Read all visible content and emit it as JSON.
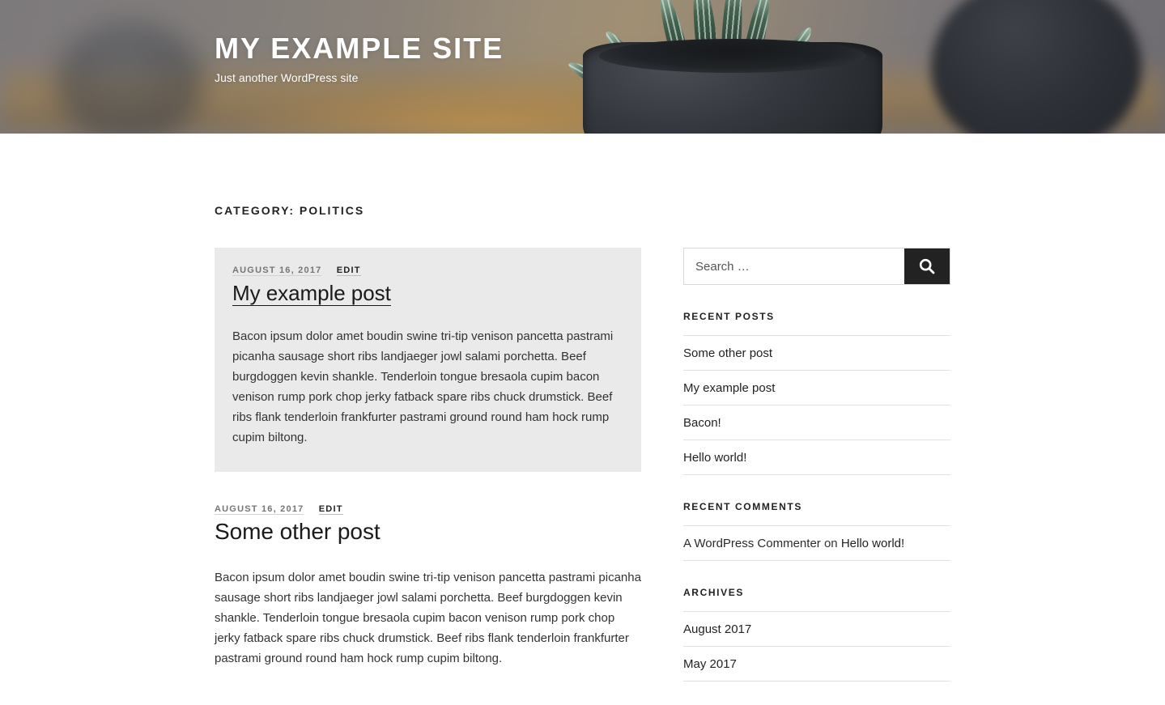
{
  "site": {
    "title": "MY EXAMPLE SITE",
    "description": "Just another WordPress site",
    "header_image": "potted-zebra-plant-photo"
  },
  "archive": {
    "page_title": "CATEGORY: POLITICS"
  },
  "posts": [
    {
      "sticky": true,
      "date": "AUGUST 16, 2017",
      "edit_label": "EDIT",
      "title": "My example post",
      "title_hovered": true,
      "excerpt": "Bacon ipsum dolor amet boudin swine tri-tip venison pancetta pastrami picanha sausage short ribs landjaeger jowl salami porchetta. Beef burgdoggen kevin shankle. Tenderloin tongue bresaola cupim bacon venison rump pork chop jerky fatback spare ribs chuck drumstick. Beef ribs flank tenderloin frankfurter pastrami ground round ham hock rump cupim biltong."
    },
    {
      "sticky": false,
      "date": "AUGUST 16, 2017",
      "edit_label": "EDIT",
      "title": "Some other post",
      "title_hovered": false,
      "excerpt": "Bacon ipsum dolor amet boudin swine tri-tip venison pancetta pastrami picanha sausage short ribs landjaeger jowl salami porchetta. Beef burgdoggen kevin shankle. Tenderloin tongue bresaola cupim bacon venison rump pork chop jerky fatback spare ribs chuck drumstick. Beef ribs flank tenderloin frankfurter pastrami ground round ham hock rump cupim biltong."
    }
  ],
  "sidebar": {
    "search": {
      "placeholder": "Search …",
      "value": "",
      "button_icon": "search-icon"
    },
    "recent_posts": {
      "title": "RECENT POSTS",
      "items": [
        "Some other post",
        "My example post",
        "Bacon!",
        "Hello world!"
      ]
    },
    "recent_comments": {
      "title": "RECENT COMMENTS",
      "items": [
        {
          "author": "A WordPress Commenter",
          "separator": " on ",
          "post": "Hello world!"
        }
      ]
    },
    "archives": {
      "title": "ARCHIVES",
      "items": [
        "August 2017",
        "May 2017"
      ]
    }
  },
  "colors": {
    "accent_dark": "#222222",
    "text": "#333333",
    "meta_gray": "#767676",
    "sticky_bg": "#eaeaea",
    "rule": "#e2e2e2"
  }
}
